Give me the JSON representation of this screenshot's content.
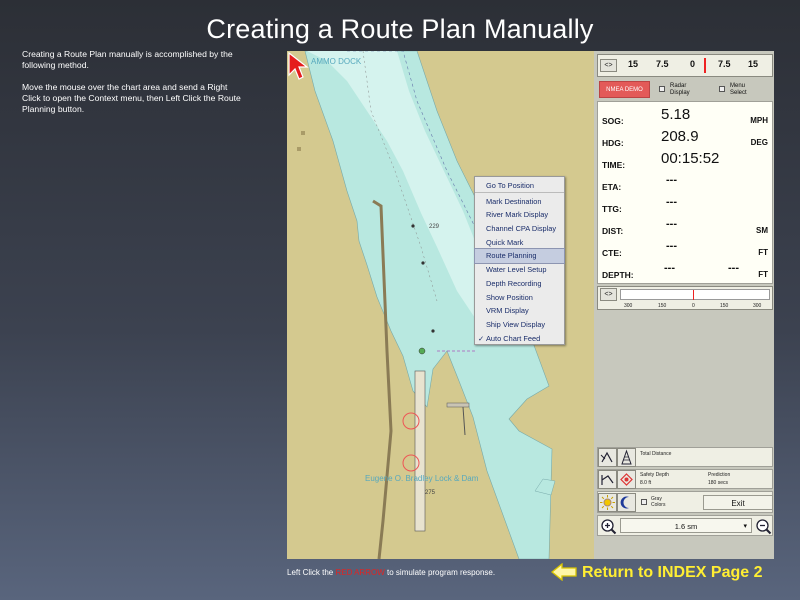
{
  "page": {
    "title": "Creating a Route Plan Manually",
    "intro": [
      "Creating a Route Plan manually is accomplished by the following method.",
      "Move the mouse over the chart area and send a Right Click to open the Context menu, then Left Click the Route Planning button."
    ],
    "footer": {
      "before": "Left Click the ",
      "emphasis": "RED ARROW",
      "after": " to simulate program response.",
      "index_link": "Return to INDEX Page 2"
    }
  },
  "chart": {
    "labels": [
      "AMMO DOCK",
      "Eugene O. Bradley Lock & Dam",
      "229",
      "275"
    ]
  },
  "context_menu": {
    "items": [
      "Go To Position",
      "Mark Destination",
      "River Mark Display",
      "Channel CPA Display",
      "Quick Mark",
      "Route Planning",
      "Water Level Setup",
      "Depth Recording",
      "Show Position",
      "VRM Display",
      "Ship View Display",
      "Auto Chart Feed"
    ],
    "selected": "Route Planning",
    "checked": "Auto Chart Feed",
    "check_glyph": "✓"
  },
  "panel": {
    "nav_glyph": "<>",
    "compass_ticks": [
      "15",
      "7.5",
      "0",
      "7.5",
      "15"
    ],
    "nmea_label": "NMEA DEMO",
    "radar_label": "Radar Display",
    "menu_label": "Menu Select",
    "readouts": [
      {
        "label": "SOG:",
        "value": "5.18",
        "unit": "MPH"
      },
      {
        "label": "HDG:",
        "value": "208.9",
        "unit": "DEG"
      },
      {
        "label": "TIME:",
        "value": "00:15:52",
        "unit": ""
      },
      {
        "label": "ETA:",
        "value": "---",
        "unit": ""
      },
      {
        "label": "TTG:",
        "value": "---",
        "unit": ""
      },
      {
        "label": "DIST:",
        "value": "---",
        "unit": "SM"
      },
      {
        "label": "CTE:",
        "value": "---",
        "unit": "FT"
      },
      {
        "label": "DEPTH:",
        "value": "---",
        "value2": "---",
        "unit": "FT"
      }
    ],
    "cpa_ticks": [
      "300",
      "150",
      "0",
      "150",
      "300"
    ],
    "total_distance_label": "Total Distance",
    "safety_depth_label": "Safety Depth",
    "safety_depth_value": "8.0 ft",
    "prediction_label": "Prediction",
    "prediction_value": "180 secs",
    "gray_colors_label": "Gray Colors",
    "exit_label": "Exit",
    "scale_value": "1.6 sm",
    "scale_arrow": "▾"
  },
  "colors": {
    "land": "#d4c98f",
    "water": "#b8e8e0",
    "red_accent": "#e02424",
    "link_yellow": "#ffee33",
    "nmea": "#e35a58"
  }
}
